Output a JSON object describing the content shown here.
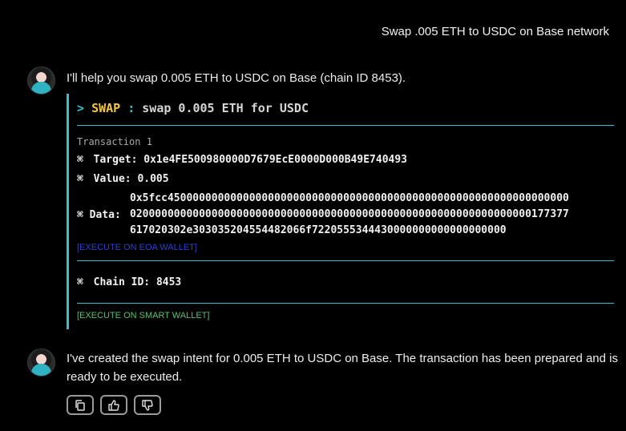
{
  "user_message": "Swap .005 ETH to USDC on Base network",
  "assistant": {
    "intro": "I'll help you swap 0.005 ETH to USDC on Base (chain ID 8453).",
    "command": {
      "prompt": ">",
      "keyword": "SWAP",
      "separator": ":",
      "description": "swap 0.005 ETH for USDC"
    },
    "transaction": {
      "label": "Transaction 1",
      "bullet": "⌘",
      "target_label": "Target:",
      "target": "0x1e4FE500980000D7679EcE0000D000B49E740493",
      "value_label": "Value:",
      "value": "0.005",
      "data_label": "Data:",
      "data_lines": [
        "0x5fcc4500000000000000000000000000000000000000000000000000000000000000",
        "0200000000000000000000000000000000000000000000000000000000000000177377",
        "617020302e303035204554482066f7220555344430000000000000000000"
      ],
      "execute_eoa": "[EXECUTE ON EOA WALLET]"
    },
    "chain_label": "Chain ID:",
    "chain_id": "8453",
    "execute_smart": "[EXECUTE ON SMART WALLET]",
    "final": "I've created the swap intent for 0.005 ETH to USDC on Base. The transaction has been prepared and is ready to be executed."
  },
  "actions": {
    "copy_icon": "copy-icon",
    "thumbs_up_icon": "thumbs-up-icon",
    "thumbs_down_icon": "thumbs-down-icon"
  },
  "colors": {
    "background": "#000000",
    "accent": "#36c3ce",
    "keyword": "#f4c542",
    "eoa_link": "#2b3fd6",
    "smart_link": "#58c26a"
  }
}
